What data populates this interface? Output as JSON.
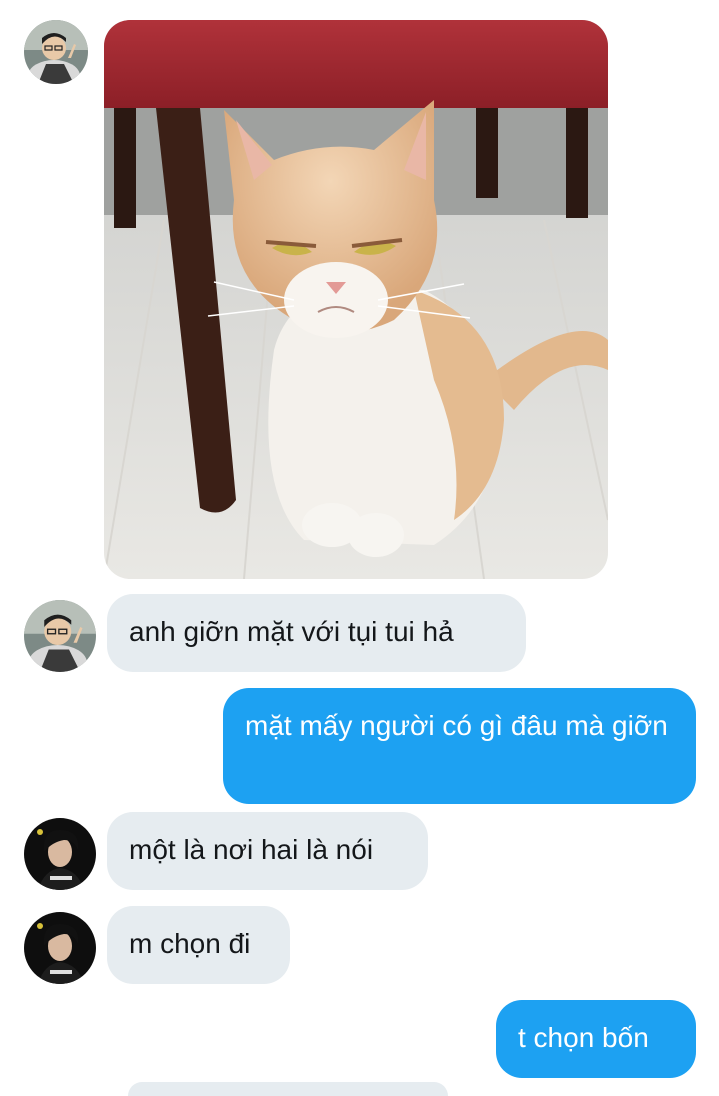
{
  "theme": {
    "incoming_bg": "#e6ecf0",
    "outgoing_bg": "#1da1f2"
  },
  "messages": [
    {
      "direction": "incoming",
      "type": "image",
      "sender_avatar": "avatar-user-1",
      "image": "angry-cat-photo"
    },
    {
      "direction": "incoming",
      "type": "text",
      "sender_avatar": "avatar-user-1",
      "text": "anh giỡn mặt với tụi tui hả"
    },
    {
      "direction": "outgoing",
      "type": "text",
      "text": "mặt mấy người có gì đâu mà giỡn"
    },
    {
      "direction": "incoming",
      "type": "text",
      "sender_avatar": "avatar-user-2",
      "text": "một là nơi hai là nói"
    },
    {
      "direction": "incoming",
      "type": "text",
      "sender_avatar": "avatar-user-2",
      "text": "m chọn đi"
    },
    {
      "direction": "outgoing",
      "type": "text",
      "text": "t chọn bốn"
    }
  ]
}
